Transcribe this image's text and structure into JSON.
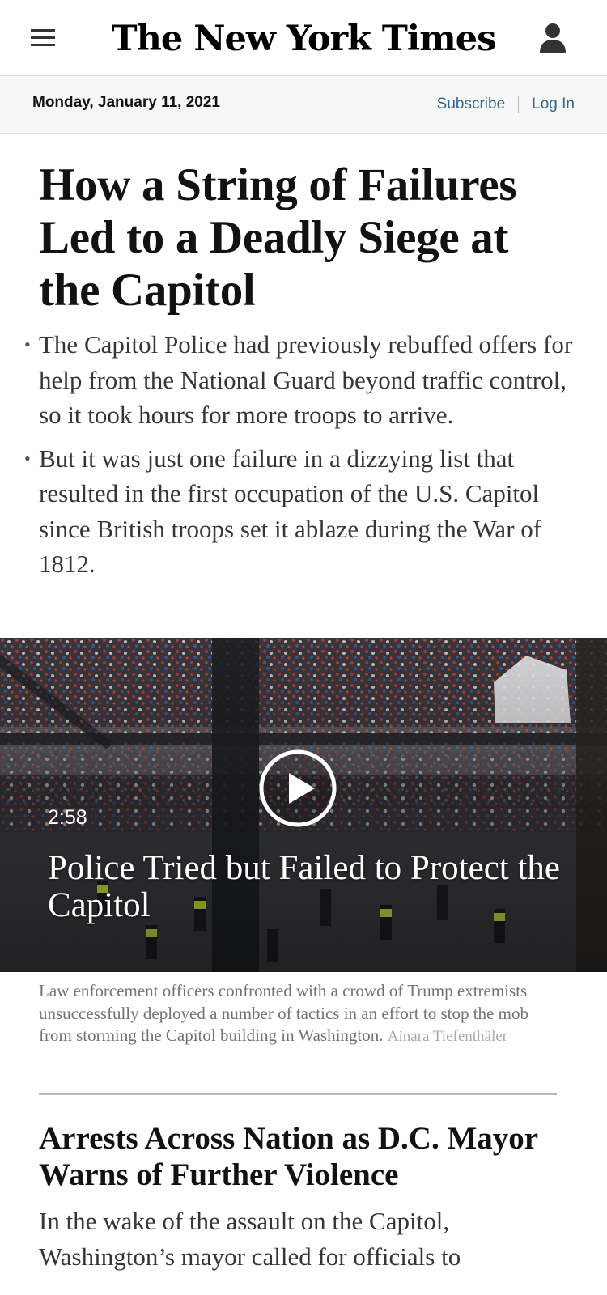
{
  "masthead": {
    "logo_text": "The New York Times",
    "menu_icon": "hamburger-menu-icon",
    "account_icon": "user-account-icon"
  },
  "datebar": {
    "date": "Monday, January 11, 2021",
    "subscribe_label": "Subscribe",
    "login_label": "Log In"
  },
  "lead_story": {
    "headline": "How a String of Failures Led to a Deadly Siege at the Capitol",
    "summary": [
      "The Capitol Police had previously rebuffed offers for help from the National Guard beyond traffic control, so it took hours for more troops to arrive.",
      "But it was just one failure in a dizzying list that resulted in the first occupation of the U.S. Capitol since British troops set it ablaze during the War of 1812."
    ],
    "bullet": "•"
  },
  "video": {
    "play_icon": "play-icon",
    "duration": "2:58",
    "title": "Police Tried but Failed to Protect the Capitol",
    "caption": "Law enforcement officers confronted with a crowd of Trump extremists unsuccessfully deployed a number of tactics in an effort to stop the mob from storming the Capitol building in Washington.",
    "credit": "Ainara Tiefenthäler"
  },
  "second_story": {
    "headline": "Arrests Across Nation as D.C. Mayor Warns of Further Violence",
    "summary": "In the wake of the assault on the Capitol, Washington’s mayor called for officials to"
  },
  "colors": {
    "link": "#326891",
    "text": "#121212",
    "summary_text": "#363636",
    "caption_text": "#727272",
    "credit_text": "#a8a8a8",
    "datebar_bg": "#f7f7f7"
  }
}
